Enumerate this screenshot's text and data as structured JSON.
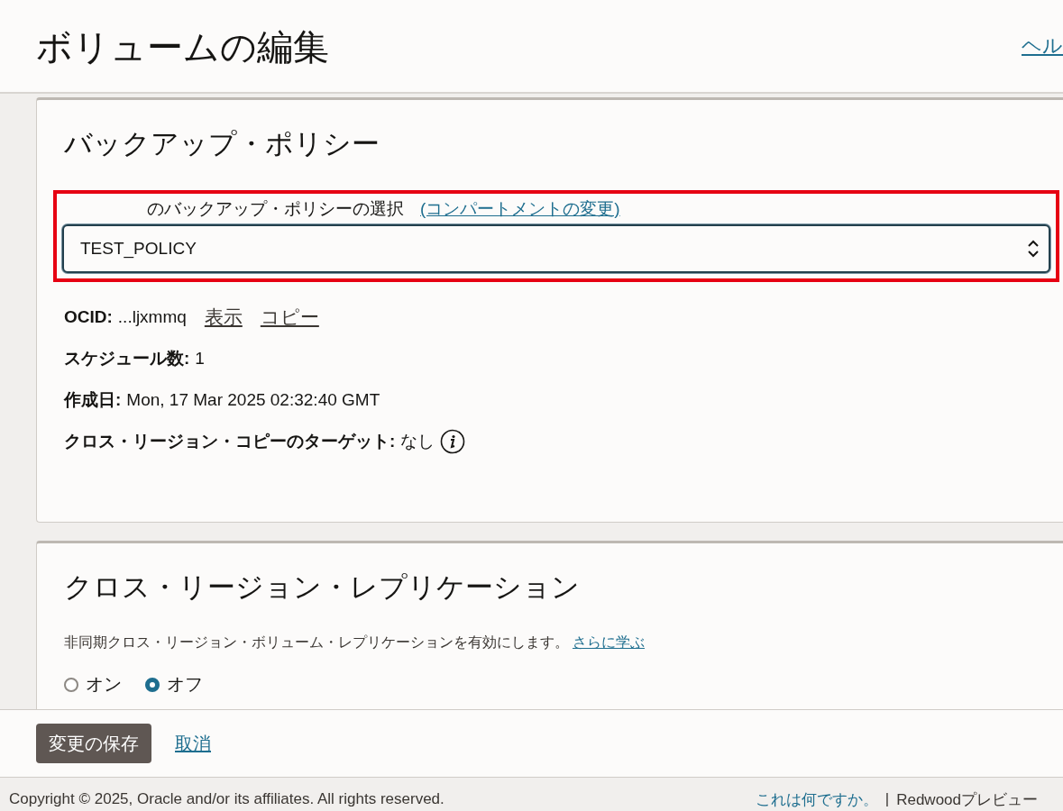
{
  "header": {
    "title": "ボリュームの編集",
    "help_link": "ヘル"
  },
  "backup_policy": {
    "title": "バックアップ・ポリシー",
    "highlighted": true,
    "select_label": "のバックアップ・ポリシーの選択",
    "compartment_link": "(コンパートメントの変更)",
    "selected_policy": "TEST_POLICY",
    "details": [
      {
        "label": "OCID:",
        "value": "...ljxmmq",
        "links": [
          "表示",
          "コピー"
        ],
        "info": false
      },
      {
        "label": "スケジュール数:",
        "value": "1",
        "info": false
      },
      {
        "label": "作成日:",
        "value": "Mon, 17 Mar 2025 02:32:40 GMT",
        "info": false
      },
      {
        "label": "クロス・リージョン・コピーのターゲット:",
        "value": "なし",
        "info": true
      }
    ]
  },
  "replication": {
    "title": "クロス・リージョン・レプリケーション",
    "description": "非同期クロス・リージョン・ボリューム・レプリケーションを有効にします。",
    "learn_more": "さらに学ぶ",
    "options": [
      {
        "label": "オン",
        "selected": false
      },
      {
        "label": "オフ",
        "selected": true
      }
    ]
  },
  "actions": {
    "save": "変更の保存",
    "cancel": "取消"
  },
  "footer": {
    "copyright": "Copyright © 2025, Oracle and/or its affiliates. All rights reserved.",
    "links": [
      "これは何ですか。",
      "Redwoodプレビュー"
    ],
    "separator": "|"
  }
}
